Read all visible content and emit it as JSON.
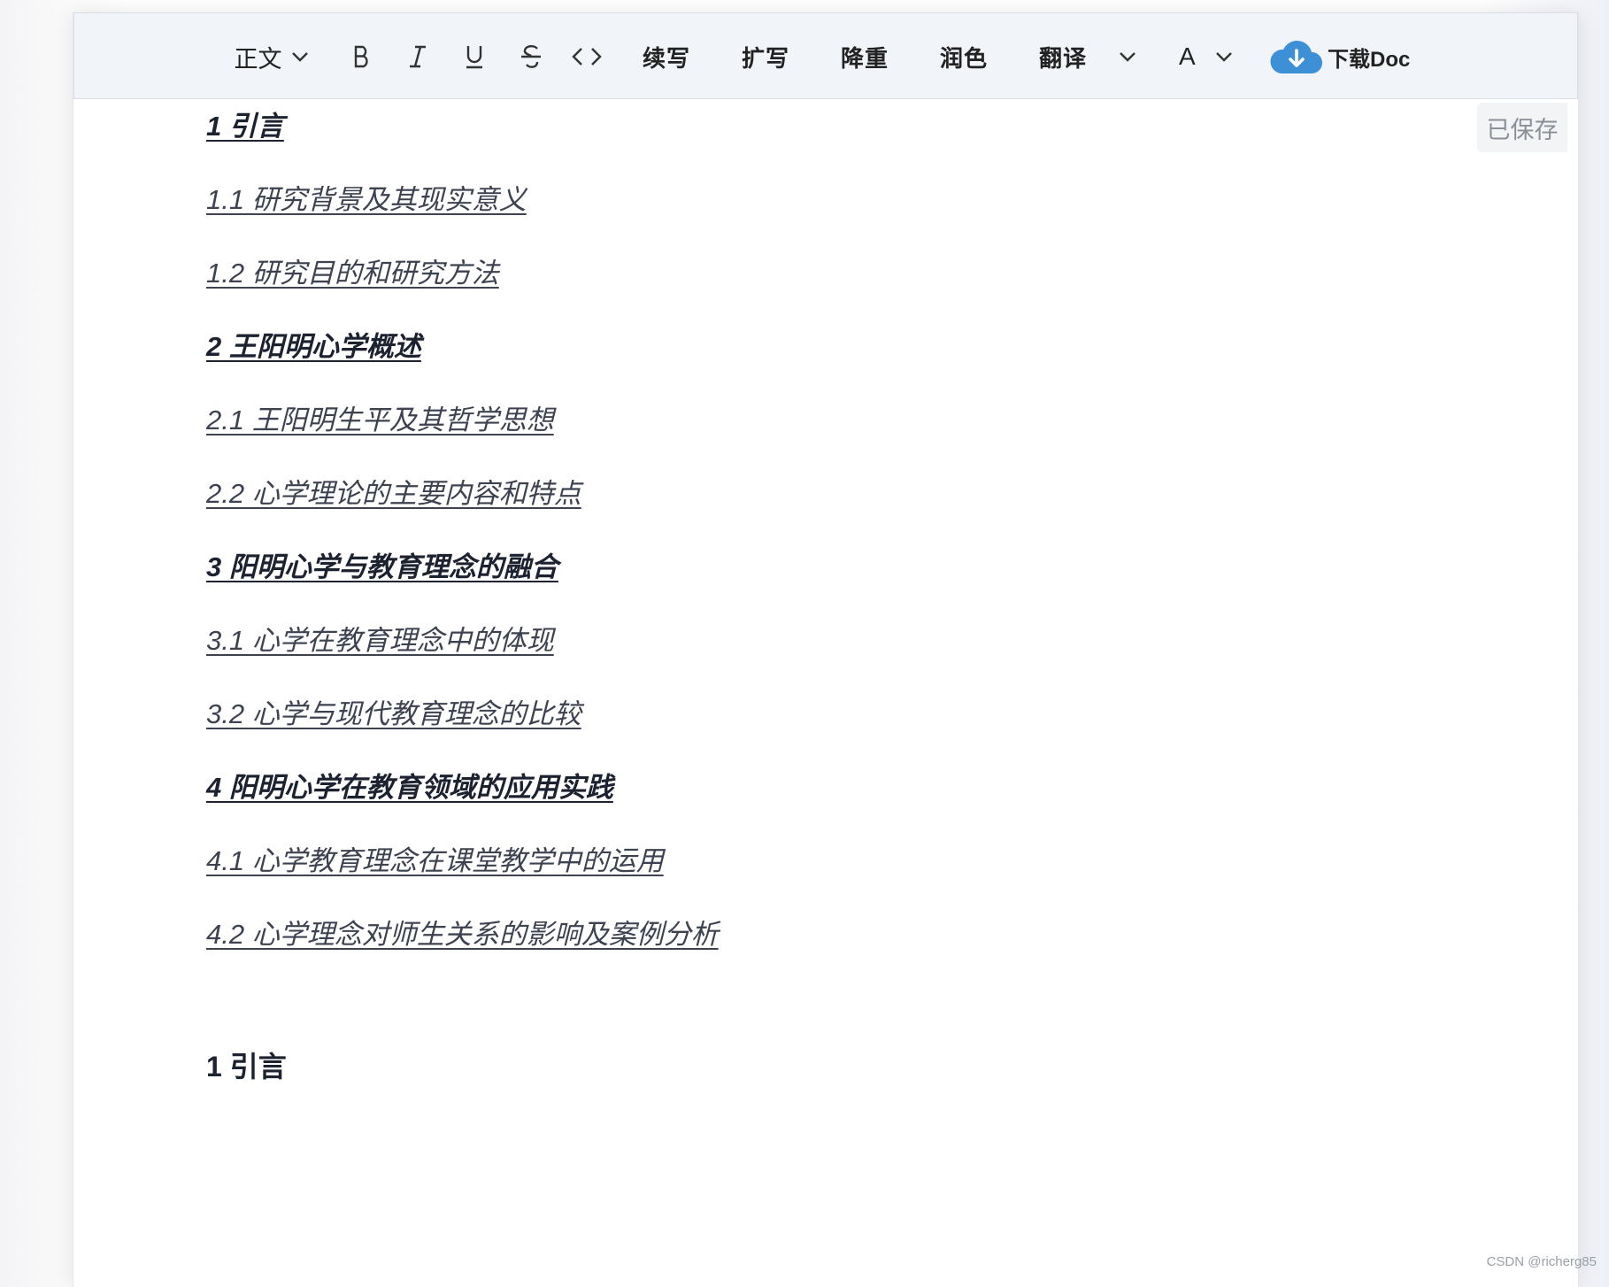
{
  "toolbar": {
    "style_select": "正文",
    "continue_label": "续写",
    "expand_label": "扩写",
    "dedupe_label": "降重",
    "polish_label": "润色",
    "translate_label": "翻译",
    "font_label": "A",
    "download_label": "下载Doc"
  },
  "status": {
    "saved": "已保存"
  },
  "toc": [
    {
      "text": "1 引言",
      "level": 1
    },
    {
      "text": "1.1 研究背景及其现实意义",
      "level": 2
    },
    {
      "text": "1.2 研究目的和研究方法",
      "level": 2
    },
    {
      "text": "2 王阳明心学概述",
      "level": 1
    },
    {
      "text": "2.1 王阳明生平及其哲学思想",
      "level": 2
    },
    {
      "text": "2.2 心学理论的主要内容和特点",
      "level": 2
    },
    {
      "text": "3 阳明心学与教育理念的融合",
      "level": 1
    },
    {
      "text": "3.1 心学在教育理念中的体现",
      "level": 2
    },
    {
      "text": "3.2 心学与现代教育理念的比较",
      "level": 2
    },
    {
      "text": "4 阳明心学在教育领域的应用实践",
      "level": 1
    },
    {
      "text": "4.1 心学教育理念在课堂教学中的运用",
      "level": 2
    },
    {
      "text": "4.2 心学理念对师生关系的影响及案例分析",
      "level": 2
    }
  ],
  "body": {
    "heading": "1 引言"
  },
  "watermark": "CSDN @richerg85",
  "colors": {
    "accent_cloud": "#3d8fd6",
    "toolbar_bg": "#f1f4f9",
    "text": "#3c4250"
  }
}
